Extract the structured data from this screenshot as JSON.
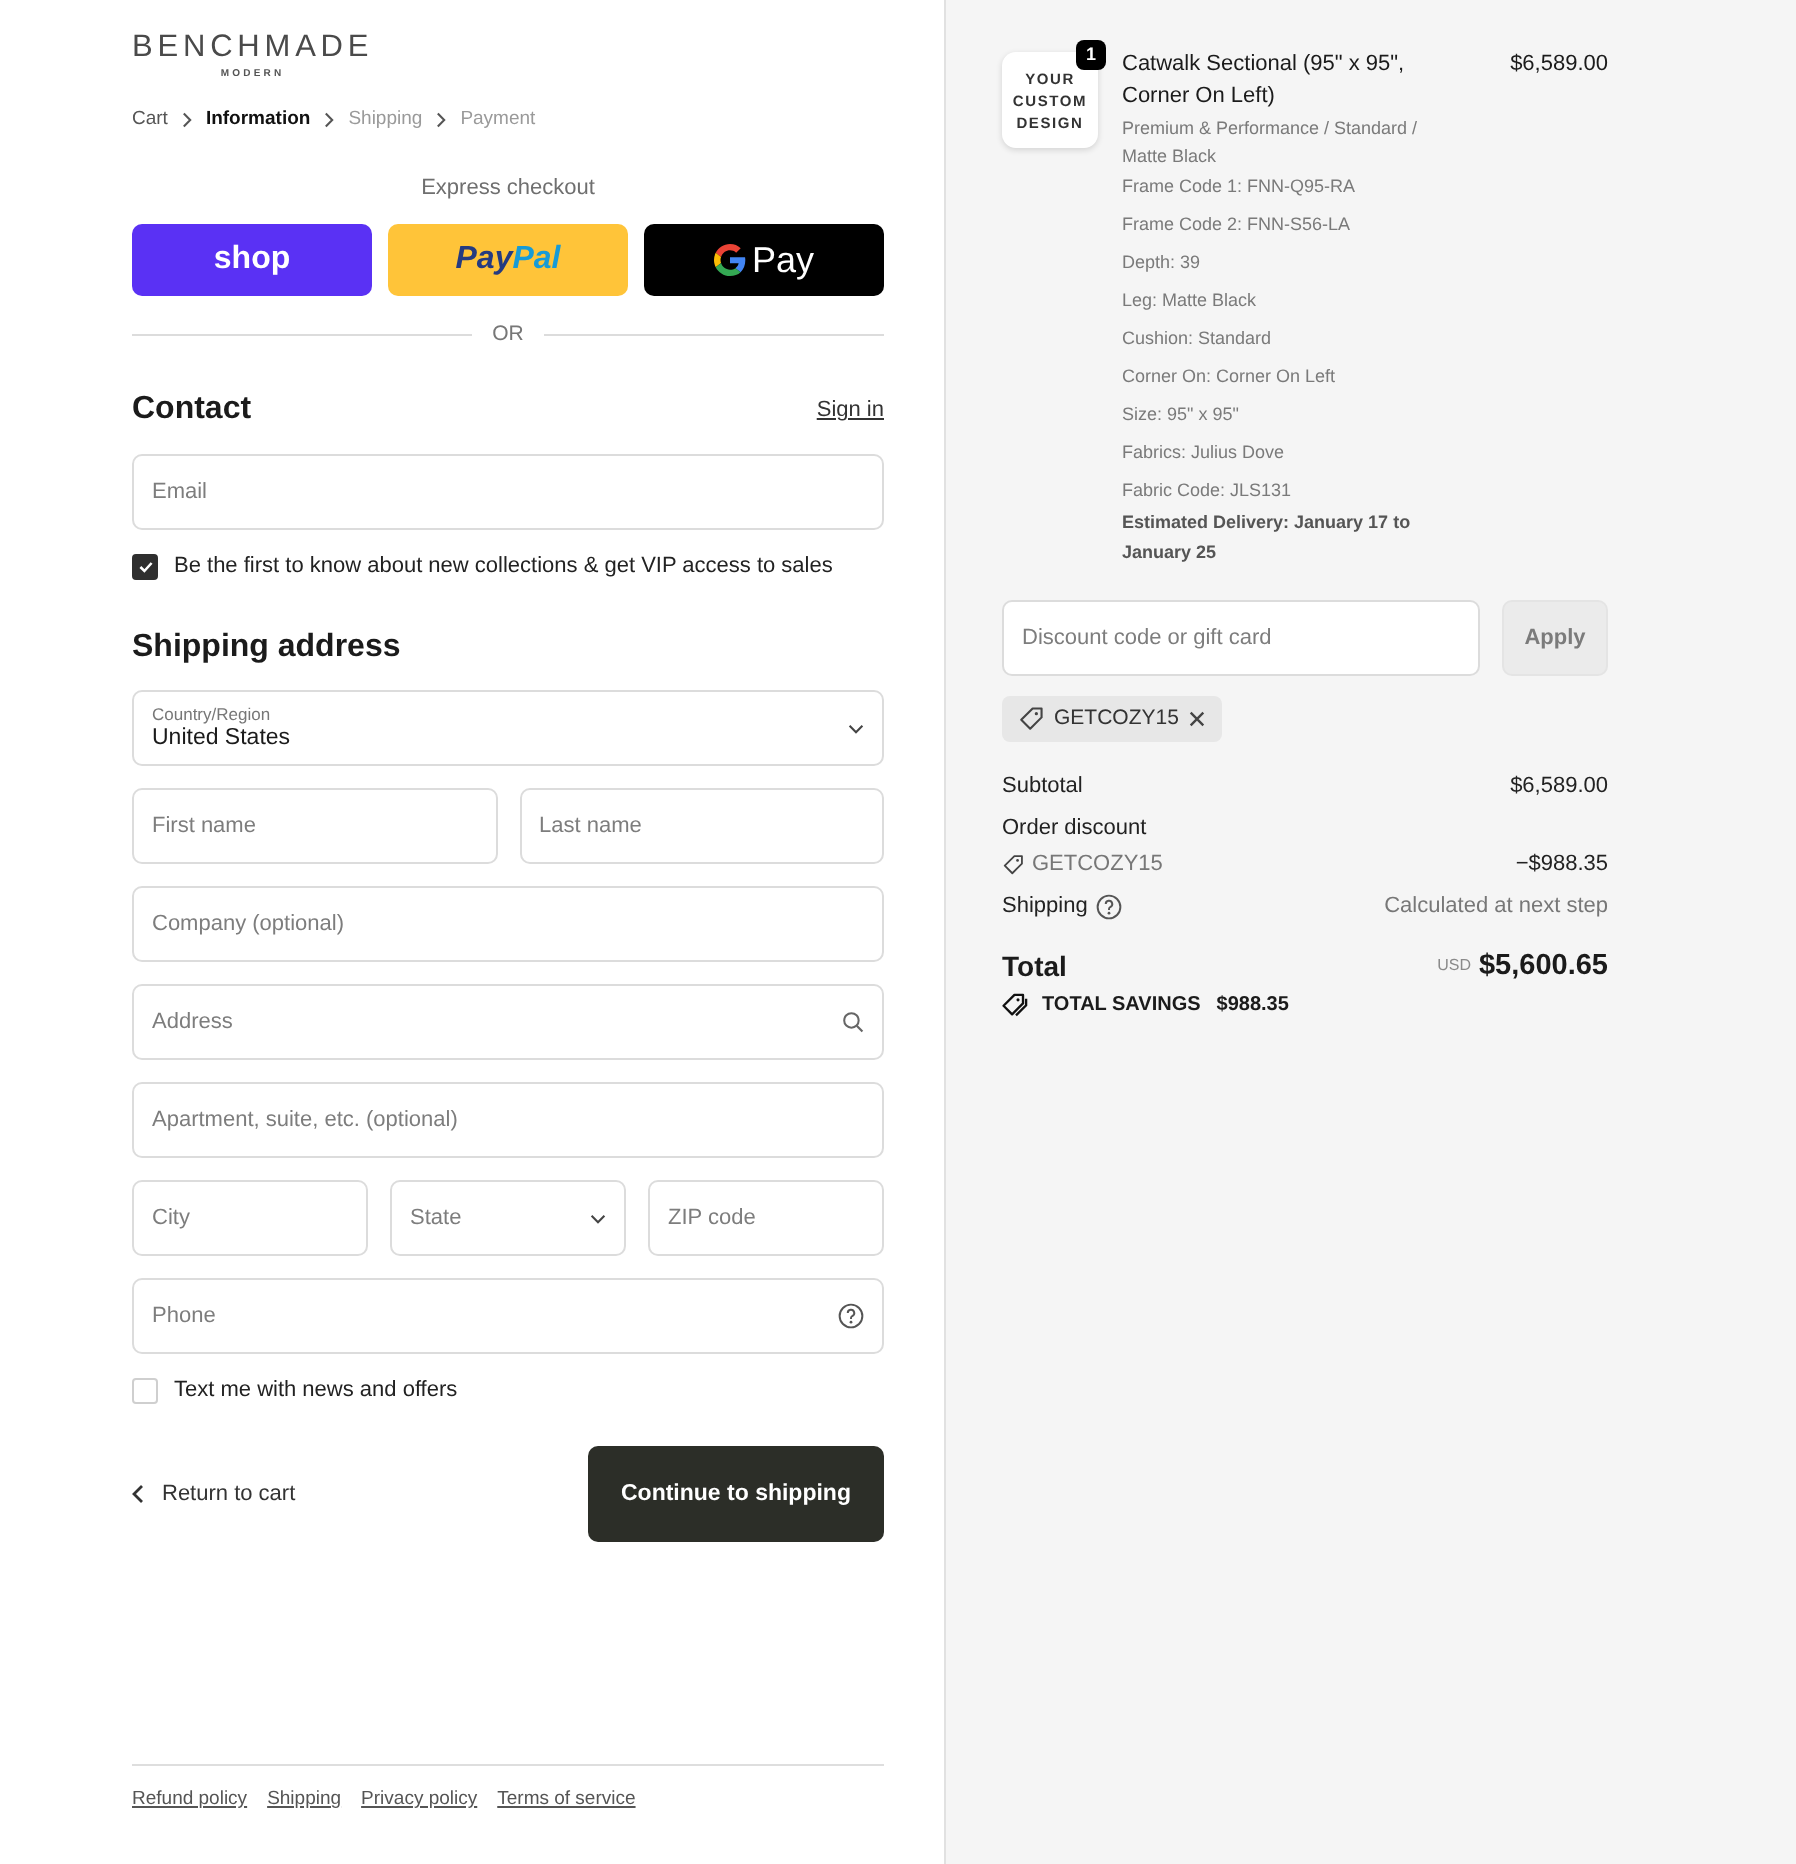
{
  "header": {
    "logo": "BENCHMADE",
    "logo_tagline": "MODERN"
  },
  "breadcrumbs": [
    {
      "label": "Cart",
      "selected": false,
      "completed": true
    },
    {
      "label": "Information",
      "selected": true,
      "completed": false
    },
    {
      "label": "Shipping",
      "selected": false,
      "completed": false
    },
    {
      "label": "Payment",
      "selected": false,
      "completed": false
    }
  ],
  "express_checkout": {
    "title": "Express checkout",
    "buttons": [
      {
        "kind": "shop",
        "label_parts": [
          "shop"
        ]
      },
      {
        "kind": "paypal",
        "label_parts": [
          "Pay",
          "Pal"
        ]
      },
      {
        "kind": "gpay",
        "label_parts": [
          "Pay"
        ]
      }
    ],
    "divider": "OR"
  },
  "contact": {
    "title": "Contact",
    "sign_in": "Sign in",
    "email": {
      "kind": "text",
      "placeholder": "Email"
    },
    "newsletter": {
      "label": "Be the first to know about new collections & get VIP access to sales",
      "checked": true
    }
  },
  "shipping_address": {
    "title": "Shipping address",
    "rows": [
      [
        {
          "kind": "select",
          "label": "Country/Region",
          "value": "United States"
        }
      ],
      [
        {
          "kind": "text",
          "placeholder": "First name"
        },
        {
          "kind": "text",
          "placeholder": "Last name"
        }
      ],
      [
        {
          "kind": "text",
          "placeholder": "Company (optional)"
        }
      ],
      [
        {
          "kind": "search",
          "placeholder": "Address"
        }
      ],
      [
        {
          "kind": "text",
          "placeholder": "Apartment, suite, etc. (optional)"
        }
      ],
      [
        {
          "kind": "text",
          "placeholder": "City"
        },
        {
          "kind": "select",
          "placeholder": "State"
        },
        {
          "kind": "text",
          "placeholder": "ZIP code"
        }
      ],
      [
        {
          "kind": "help",
          "placeholder": "Phone"
        }
      ]
    ],
    "sms": {
      "label": "Text me with news and offers",
      "checked": false
    }
  },
  "actions": {
    "return_link": "Return to cart",
    "continue_button": "Continue to shipping"
  },
  "footer_links": [
    "Refund policy",
    "Shipping",
    "Privacy policy",
    "Terms of service"
  ],
  "order_summary": {
    "items": [
      {
        "thumbnail_text": "YOUR CUSTOM DESIGN",
        "quantity": "1",
        "title": "Catwalk Sectional (95\" x 95\", Corner On Left)",
        "variant": "Premium & Performance / Standard / Matte Black",
        "properties": [
          "Frame Code 1: FNN-Q95-RA",
          "Frame Code 2: FNN-S56-LA",
          "Depth: 39",
          "Leg: Matte Black",
          "Cushion: Standard",
          "Corner On: Corner On Left",
          "Size: 95\" x 95\"",
          "Fabrics: Julius Dove",
          "Fabric Code: JLS131"
        ],
        "delivery": "Estimated Delivery: January 17 to January 25",
        "price": "$6,589.00"
      }
    ],
    "discount": {
      "placeholder": "Discount code or gift card",
      "apply_button": "Apply",
      "apply_disabled": true,
      "applied_codes": [
        "GETCOZY15"
      ]
    },
    "lines": [
      {
        "kind": "plain",
        "label": "Subtotal",
        "value": "$6,589.00"
      },
      {
        "kind": "discount",
        "label": "Order discount",
        "code": "GETCOZY15",
        "value": "−$988.35"
      },
      {
        "kind": "help",
        "label": "Shipping",
        "value": "Calculated at next step"
      }
    ],
    "total": {
      "label": "Total",
      "currency": "USD",
      "value": "$5,600.65"
    },
    "savings": {
      "label": "TOTAL SAVINGS",
      "value": "$988.35"
    }
  }
}
